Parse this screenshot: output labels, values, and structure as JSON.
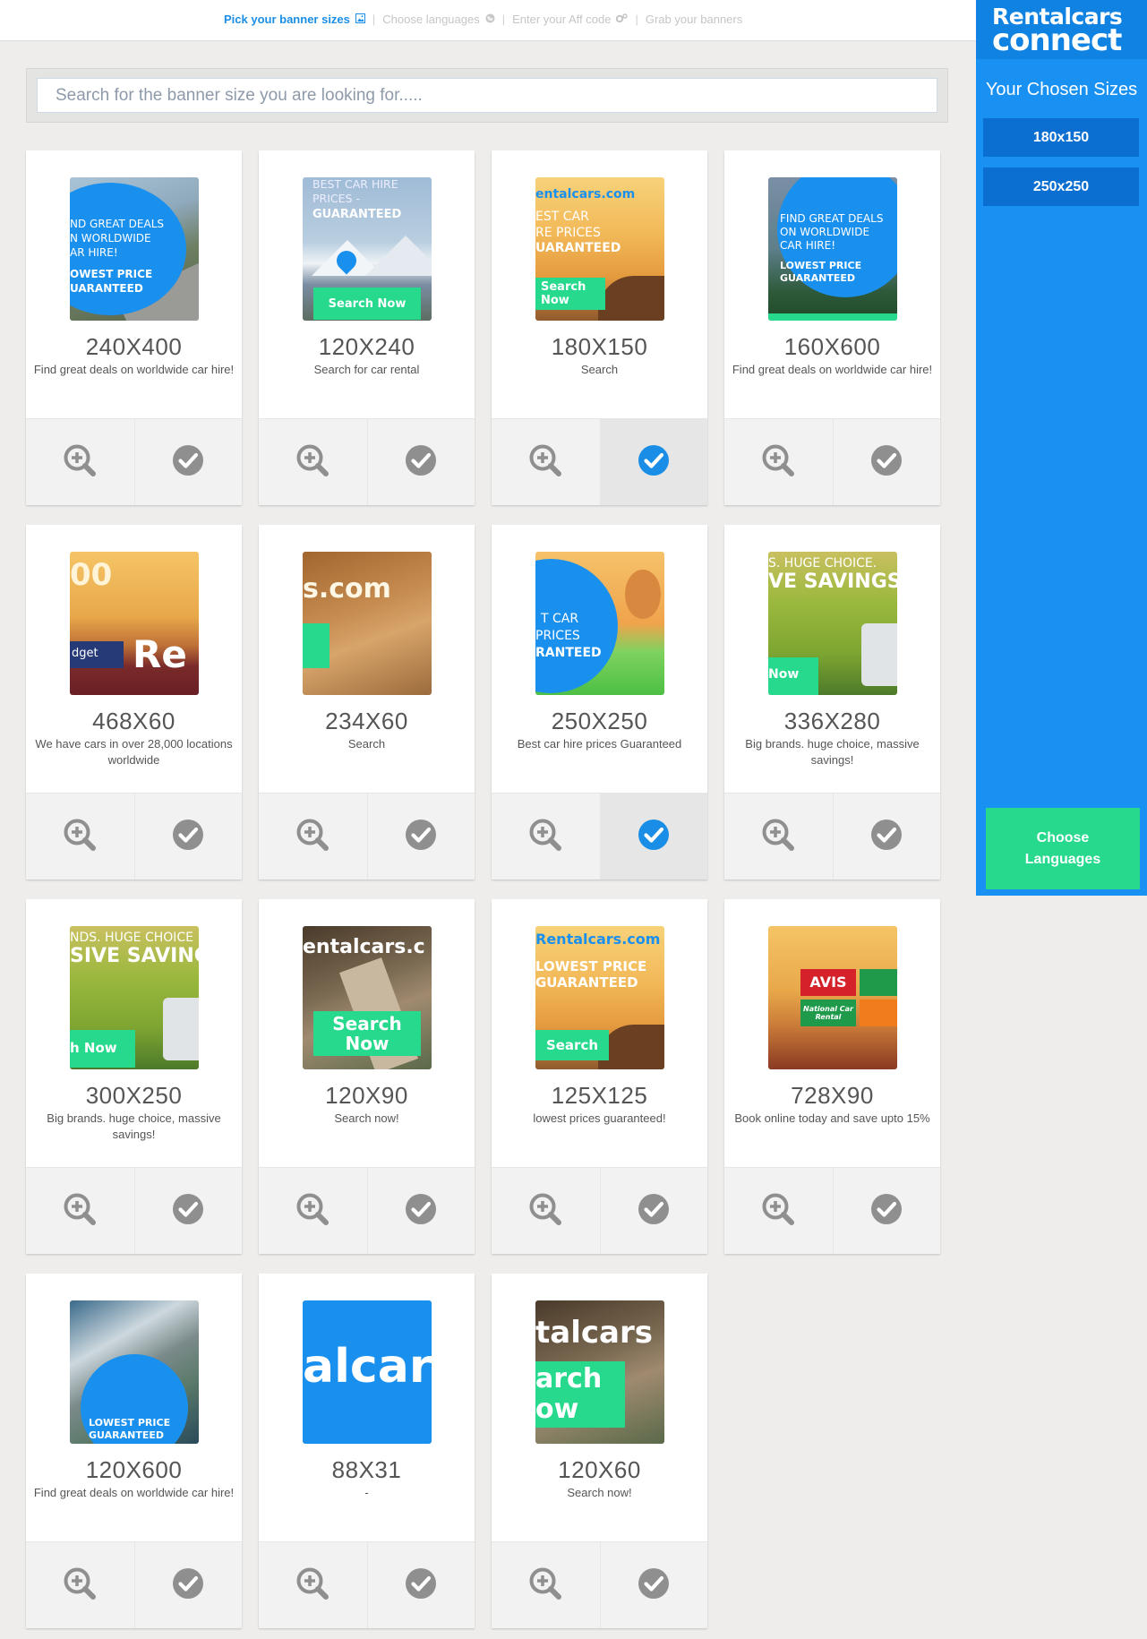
{
  "steps": [
    {
      "label": "Pick your banner sizes",
      "active": true,
      "icon": "image-icon"
    },
    {
      "label": "Choose languages",
      "active": false,
      "icon": "globe-icon"
    },
    {
      "label": "Enter your Aff code",
      "active": false,
      "icon": "cogs-icon"
    },
    {
      "label": "Grab your banners",
      "active": false
    }
  ],
  "search": {
    "placeholder": "Search for the banner size you are looking for....."
  },
  "banners": [
    {
      "size": "240X400",
      "description": "Find great deals on worldwide car hire!",
      "selected": false,
      "thumb_text": [
        "ND GREAT DEALS",
        "N WORLDWIDE",
        "AR HIRE!",
        "OWEST PRICE",
        "UARANTEED"
      ]
    },
    {
      "size": "120X240",
      "description": "Search for car rental",
      "selected": false,
      "thumb_text": [
        "BEST CAR HIRE",
        "PRICES -",
        "GUARANTEED",
        "Search Now"
      ]
    },
    {
      "size": "180X150",
      "description": "Search",
      "selected": true,
      "thumb_text": [
        "entalcars.com",
        "EST CAR",
        "RE PRICES",
        "UARANTEED",
        "Search",
        "Now"
      ]
    },
    {
      "size": "160X600",
      "description": "Find great deals on worldwide car hire!",
      "selected": false,
      "thumb_text": [
        "FIND GREAT DEALS",
        "ON WORLDWIDE",
        "CAR HIRE!",
        "LOWEST PRICE",
        "GUARANTEED"
      ]
    },
    {
      "size": "468X60",
      "description": "We have cars in over 28,000 locations worldwide",
      "selected": false,
      "thumb_text": [
        "00",
        "dget",
        "Re"
      ]
    },
    {
      "size": "234X60",
      "description": "Search",
      "selected": false,
      "thumb_text": [
        "s.com"
      ]
    },
    {
      "size": "250X250",
      "description": "Best car hire prices Guaranteed",
      "selected": true,
      "thumb_text": [
        "T CAR",
        "PRICES",
        "RANTEED"
      ]
    },
    {
      "size": "336X280",
      "description": "Big brands. huge choice, massive savings!",
      "selected": false,
      "thumb_text": [
        "S. HUGE CHOICE.",
        "VE SAVINGS",
        "Now"
      ]
    },
    {
      "size": "300X250",
      "description": "Big brands. huge choice, massive savings!",
      "selected": false,
      "thumb_text": [
        "NDS. HUGE CHOICE",
        "SIVE SAVING",
        "h Now"
      ]
    },
    {
      "size": "120X90",
      "description": "Search now!",
      "selected": false,
      "thumb_text": [
        "entalcars.c",
        "Search",
        "Now"
      ]
    },
    {
      "size": "125X125",
      "description": "lowest prices guaranteed!",
      "selected": false,
      "thumb_text": [
        "Rentalcars.com",
        "LOWEST PRICE",
        "GUARANTEED",
        "Search"
      ]
    },
    {
      "size": "728X90",
      "description": "Book online today and save upto 15%",
      "selected": false,
      "thumb_text": [
        "AVIS",
        "National Car Rental"
      ]
    },
    {
      "size": "120X600",
      "description": "Find great deals on worldwide car hire!",
      "selected": false,
      "thumb_text": [
        "LOWEST PRICE",
        "GUARANTEED"
      ]
    },
    {
      "size": "88X31",
      "description": "-",
      "selected": false,
      "thumb_text": [
        "alcar"
      ]
    },
    {
      "size": "120X60",
      "description": "Search now!",
      "selected": false,
      "thumb_text": [
        "talcars",
        "arch",
        "ow"
      ]
    }
  ],
  "panel": {
    "logo_line1": "Rentalcars",
    "logo_line2": "connect",
    "title": "Your Chosen Sizes",
    "chosen_sizes": [
      "180x150",
      "250x250"
    ],
    "choose_button": "Choose Languages"
  },
  "colors": {
    "accent": "#1991f3",
    "green": "#27d98d",
    "check_selected": "#1a8ee6",
    "check_default": "#8f8f8f"
  }
}
